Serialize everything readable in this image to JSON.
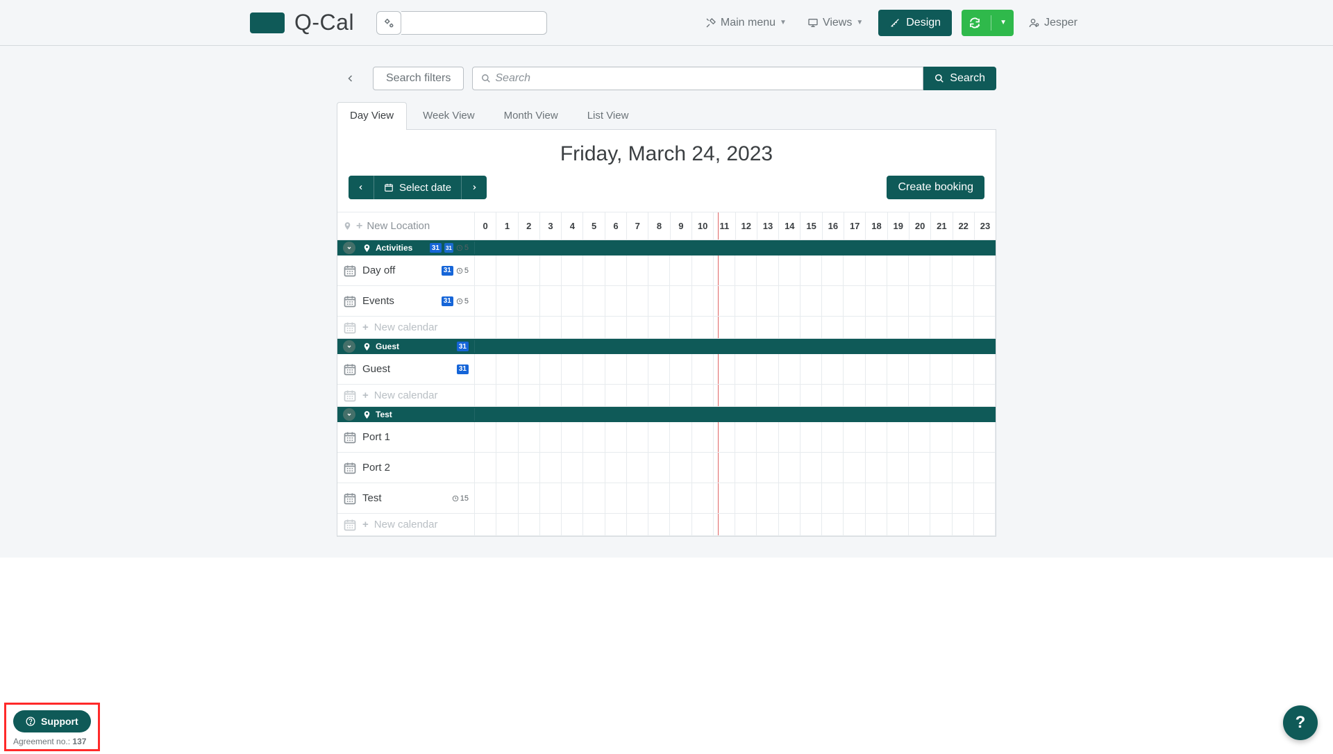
{
  "brand": {
    "name": "Q-Cal"
  },
  "navbar": {
    "main_menu": "Main menu",
    "views": "Views",
    "design": "Design",
    "user": "Jesper"
  },
  "search": {
    "filters_label": "Search filters",
    "placeholder": "Search",
    "button": "Search"
  },
  "tabs": [
    {
      "id": "day",
      "label": "Day View",
      "active": true
    },
    {
      "id": "week",
      "label": "Week View",
      "active": false
    },
    {
      "id": "month",
      "label": "Month View",
      "active": false
    },
    {
      "id": "list",
      "label": "List View",
      "active": false
    }
  ],
  "date_title": "Friday, March 24, 2023",
  "toolbar": {
    "select_date": "Select date",
    "create_booking": "Create booking"
  },
  "grid": {
    "new_location": "New Location",
    "new_calendar": "New calendar",
    "hours_start": 0,
    "hours_end": 23,
    "now_hour": 11,
    "sections": [
      {
        "name": "Activities",
        "badges": {
          "blue": "31",
          "blueTop": "31",
          "clock": "5"
        },
        "calendars": [
          {
            "name": "Day off",
            "badges": {
              "blue": "31",
              "clock": "5"
            }
          },
          {
            "name": "Events",
            "badges": {
              "blue": "31",
              "clock": "5"
            }
          }
        ]
      },
      {
        "name": "Guest",
        "badges": {
          "blue": "31"
        },
        "calendars": [
          {
            "name": "Guest",
            "badges": {
              "blue": "31"
            }
          }
        ]
      },
      {
        "name": "Test",
        "calendars": [
          {
            "name": "Port 1"
          },
          {
            "name": "Port 2"
          },
          {
            "name": "Test",
            "badges": {
              "clock": "15"
            }
          }
        ]
      }
    ]
  },
  "support": {
    "label": "Support",
    "agreement_prefix": "Agreement no.: ",
    "agreement_no": "137"
  }
}
